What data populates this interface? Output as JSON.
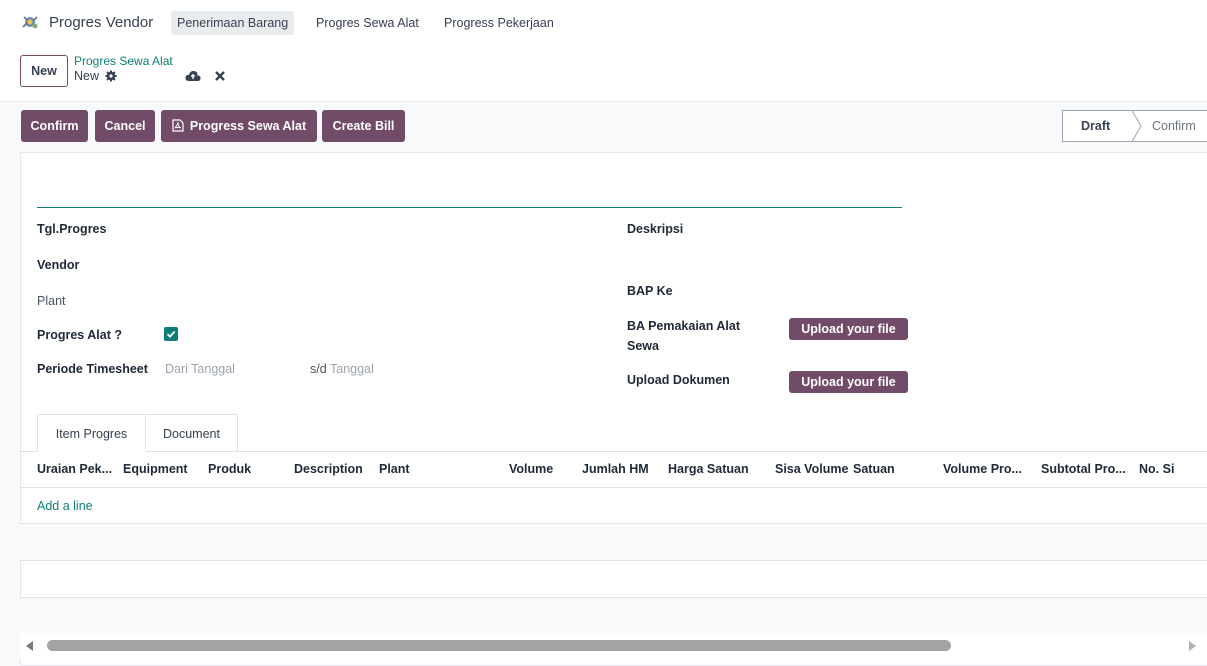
{
  "nav": {
    "app_name": "Progres Vendor",
    "items": [
      "Penerimaan Barang",
      "Progres Sewa Alat",
      "Progress Pekerjaan"
    ]
  },
  "control_panel": {
    "new_label": "New",
    "breadcrumb_parent": "Progres Sewa Alat",
    "breadcrumb_current": "New"
  },
  "actions": {
    "confirm": "Confirm",
    "cancel": "Cancel",
    "progress_sewa_alat": "Progress Sewa Alat",
    "create_bill": "Create Bill"
  },
  "statusbar": {
    "stages": [
      "Draft",
      "Confirm"
    ],
    "active_stage": "Draft"
  },
  "form": {
    "tgl_progres": "Tgl.Progres",
    "vendor": "Vendor",
    "plant": "Plant",
    "progres_alat": "Progres Alat ?",
    "progres_alat_checked": true,
    "periode_timesheet": "Periode Timesheet",
    "dari_tanggal_placeholder": "Dari Tanggal",
    "sd": "s/d",
    "tanggal_placeholder": "Tanggal",
    "deskripsi": "Deskripsi",
    "bap_ke": "BAP Ke",
    "ba_pemakaian_line1": "BA Pemakaian Alat",
    "ba_pemakaian_line2": "Sewa",
    "upload_dokumen": "Upload Dokumen",
    "upload_label": "Upload your file"
  },
  "tabs": {
    "items": [
      "Item Progres",
      "Document"
    ],
    "active": "Item Progres"
  },
  "table": {
    "headers": [
      "Uraian Pek...",
      "Equipment",
      "Produk",
      "Description",
      "Plant",
      "Volume",
      "Jumlah HM",
      "Harga Satuan",
      "Sisa Volume",
      "Satuan",
      "Volume Pro...",
      "Subtotal Pro...",
      "No. Si"
    ],
    "add_line": "Add a line"
  },
  "colors": {
    "primary": "#714b67",
    "accent": "#0f7d77"
  }
}
